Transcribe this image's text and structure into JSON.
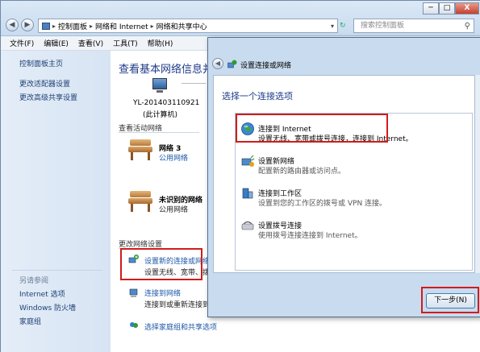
{
  "window": {
    "breadcrumbs": [
      "控制面板",
      "网络和 Internet",
      "网络和共享中心"
    ],
    "search_placeholder": "搜索控制面板",
    "min": "─",
    "max": "□",
    "close": "X"
  },
  "menu": [
    "文件(F)",
    "编辑(E)",
    "查看(V)",
    "工具(T)",
    "帮助(H)"
  ],
  "sidebar": {
    "links": [
      "控制面板主页",
      "更改适配器设置",
      "更改高级共享设置"
    ],
    "see_also_heading": "另请参阅",
    "see_also": [
      "Internet 选项",
      "Windows 防火墙",
      "家庭组"
    ]
  },
  "main": {
    "title": "查看基本网络信息并设置",
    "computer_name": "YL-201403110921",
    "computer_sub": "(此计算机)",
    "active_networks_heading": "查看活动网络",
    "networks": [
      {
        "name": "网络  3",
        "type": "公用网络"
      },
      {
        "name": "未识别的网络",
        "type": "公用网络"
      }
    ],
    "change_settings_heading": "更改网络设置",
    "tasks": [
      {
        "link": "设置新的连接或网络",
        "desc": "设置无线、宽带、拨"
      },
      {
        "link": "连接到网络",
        "desc": "连接到或重新连接到无"
      },
      {
        "link": "选择家庭组和共享选项",
        "desc": ""
      }
    ]
  },
  "dialog": {
    "title": "设置连接或网络",
    "prompt": "选择一个连接选项",
    "options": [
      {
        "title": "连接到 Internet",
        "desc": "设置无线、宽带或拨号连接，连接到 Internet。"
      },
      {
        "title": "设置新网络",
        "desc": "配置新的路由器或访问点。"
      },
      {
        "title": "连接到工作区",
        "desc": "设置到您的工作区的拨号或 VPN 连接。"
      },
      {
        "title": "设置拨号连接",
        "desc": "使用拨号连接连接到 Internet。"
      }
    ],
    "next_button": "下一步(N)"
  },
  "colors": {
    "highlight_box": "#d01c1c",
    "link": "#1d57a8",
    "title_blue": "#1e3a8a"
  }
}
